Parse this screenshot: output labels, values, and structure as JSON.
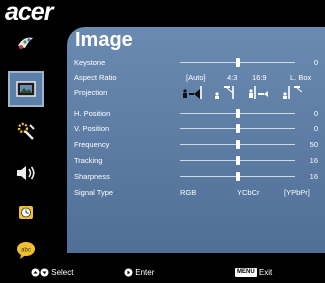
{
  "brand": "acer",
  "panel_title": "Image",
  "sidebar": {
    "items": [
      {
        "icon": "color-wheel-icon"
      },
      {
        "icon": "image-icon",
        "active": true
      },
      {
        "icon": "settings-icon"
      },
      {
        "icon": "speaker-icon"
      },
      {
        "icon": "timer-icon"
      },
      {
        "icon": "language-icon"
      }
    ]
  },
  "settings": {
    "keystone": {
      "label": "Keystone",
      "value": "0",
      "level": 0.5
    },
    "aspect_ratio": {
      "label": "Aspect Ratio",
      "options": [
        "[Auto]",
        "4:3",
        "16:9",
        "L. Box"
      ]
    },
    "projection": {
      "label": "Projection",
      "options": [
        "front-desktop-icon",
        "front-ceiling-icon",
        "rear-desktop-icon",
        "rear-ceiling-icon"
      ]
    },
    "h_position": {
      "label": "H. Position",
      "value": "0",
      "level": 0.5
    },
    "v_position": {
      "label": "V. Position",
      "value": "0",
      "level": 0.5
    },
    "frequency": {
      "label": "Frequency",
      "value": "50",
      "level": 0.5
    },
    "tracking": {
      "label": "Tracking",
      "value": "16",
      "level": 0.5
    },
    "sharpness": {
      "label": "Sharpness",
      "value": "16",
      "level": 0.5
    },
    "signal_type": {
      "label": "Signal Type",
      "options": [
        "RGB",
        "YCbCr",
        "[YPbPr]"
      ]
    }
  },
  "footer": {
    "select_label": "Select",
    "enter_label": "Enter",
    "menu_badge": "MENU",
    "exit_label": "Exit"
  }
}
